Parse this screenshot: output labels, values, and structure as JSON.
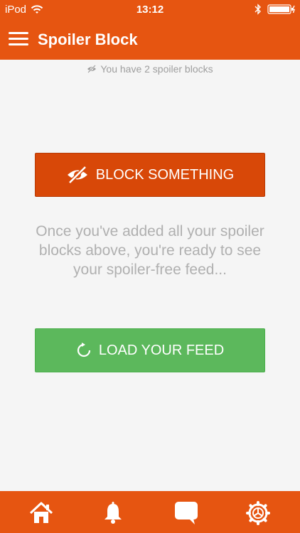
{
  "status_bar": {
    "carrier": "iPod",
    "time": "13:12"
  },
  "app_bar": {
    "title": "Spoiler Block",
    "menu_icon": "hamburger-menu-icon"
  },
  "spoiler_count_text": "You have 2 spoiler blocks",
  "block_button": {
    "label": "BLOCK SOMETHING",
    "icon": "eye-slash-icon"
  },
  "info_text": "Once you've added all your spoiler blocks above, you're ready to see your spoiler-free feed...",
  "load_button": {
    "label": "LOAD YOUR FEED",
    "icon": "refresh-icon"
  },
  "tab_bar": {
    "tabs": [
      {
        "icon": "home-icon"
      },
      {
        "icon": "bell-icon"
      },
      {
        "icon": "chat-icon"
      },
      {
        "icon": "settings-icon"
      }
    ]
  },
  "colors": {
    "primary": "#e65511",
    "block_button": "#d84808",
    "load_button": "#5cb85c",
    "background": "#f5f5f5",
    "muted_text": "#b0b0b0"
  }
}
